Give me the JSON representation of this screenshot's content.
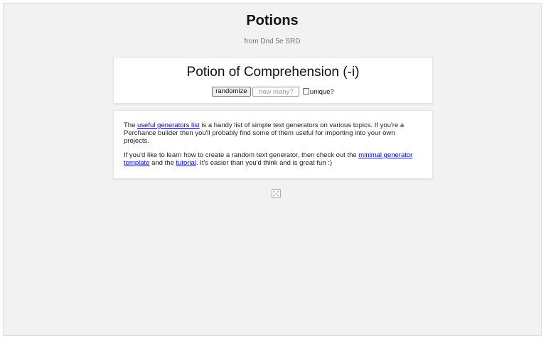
{
  "header": {
    "title": "Potions",
    "subtitle": "from Dnd 5e SRD"
  },
  "generator": {
    "output": "Potion of Comprehension (-i)",
    "randomize_label": "randomize",
    "count_placeholder": "how many?",
    "unique_label": "unique?"
  },
  "info": {
    "p1_pre": "The ",
    "p1_link": "useful generators list",
    "p1_post": " is a handy list of simple text generators on various topics. If you're a Perchance builder then you'll probably find some of them useful for importing into your own projects.",
    "p2_pre": "If you'd like to learn how to create a random text generator, then check out the ",
    "p2_link1": "minimal generator template",
    "p2_mid": " and the ",
    "p2_link2": "tutorial",
    "p2_post": ". It's easier than you'd think and is great fun :)"
  },
  "icons": {
    "dice": "dice-icon"
  }
}
